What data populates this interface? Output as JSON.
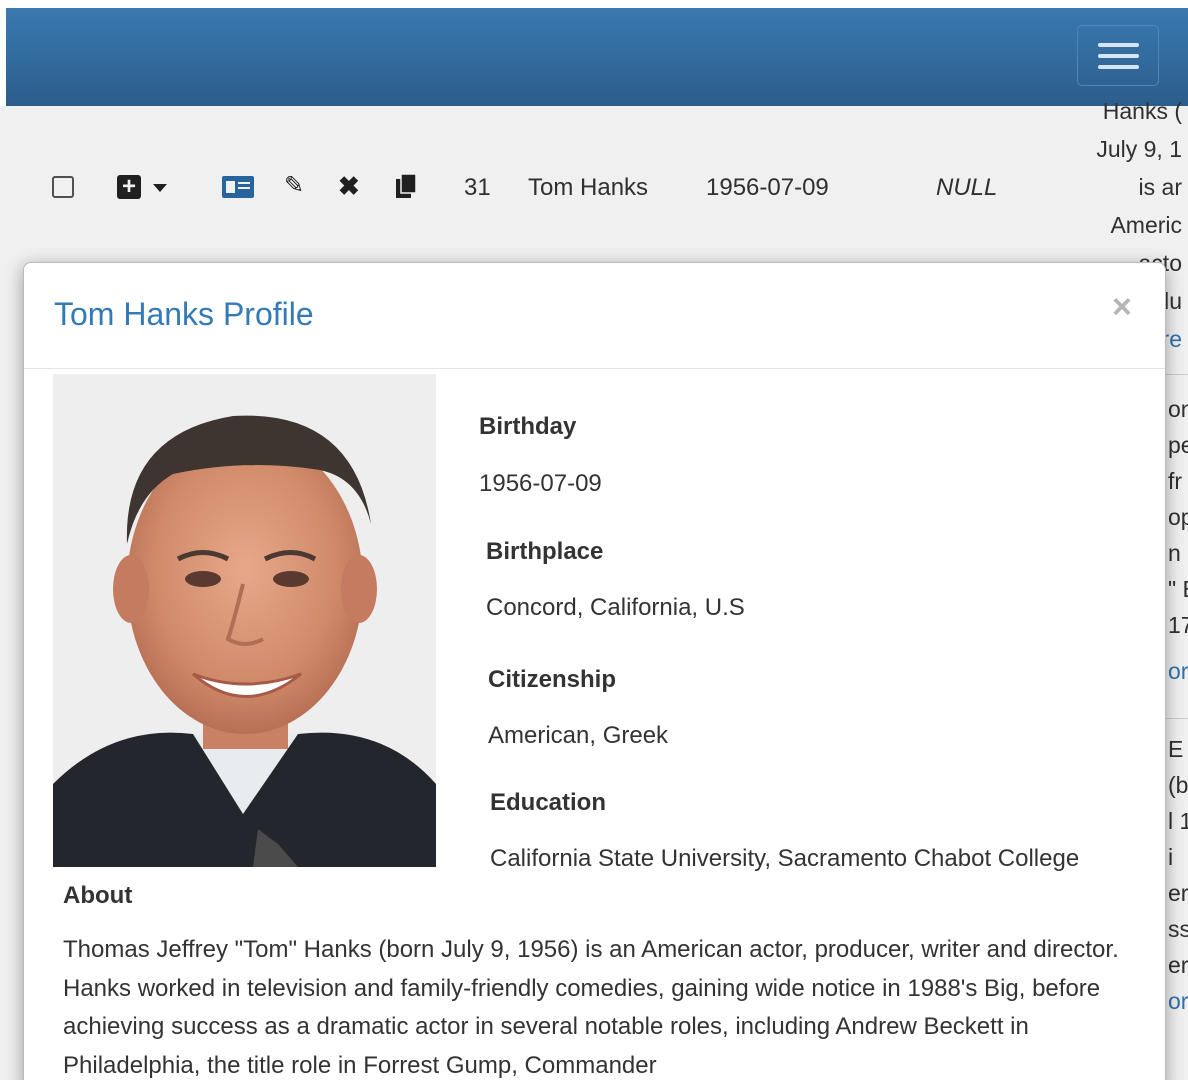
{
  "table": {
    "row": {
      "id": "31",
      "name": "Tom Hanks",
      "birthday": "1956-07-09",
      "death": "NULL",
      "bio_lines": [
        "Hanks (",
        "July 9, 1",
        "is ar",
        "Americ",
        "acto",
        "rodu",
        "ore"
      ]
    },
    "right_fragments": [
      "on",
      "pe",
      "fr",
      "op",
      "n N",
      "\" E",
      "17",
      "ore",
      "E",
      "(b",
      "l 1",
      "i",
      "eri",
      "ss",
      "er",
      "ore"
    ]
  },
  "modal": {
    "title": "Tom Hanks Profile",
    "close": "×",
    "fields": [
      {
        "label": "Birthday",
        "value": "1956-07-09"
      },
      {
        "label": "Birthplace",
        "value": "Concord, California, U.S"
      },
      {
        "label": "Citizenship",
        "value": "American, Greek"
      },
      {
        "label": "Education",
        "value": "California State University, Sacramento Chabot College"
      }
    ],
    "about_label": "About",
    "about_text": "Thomas Jeffrey \"Tom\" Hanks (born July 9, 1956) is an American actor, producer, writer and director. Hanks worked in television and family-friendly comedies, gaining wide notice in 1988's Big, before achieving success as a dramatic actor in several notable roles, including Andrew Beckett in Philadelphia, the title role in Forrest Gump, Commander"
  },
  "colors": {
    "navbar": "#2b5d8b",
    "title": "#337ab7",
    "text": "#333333"
  }
}
